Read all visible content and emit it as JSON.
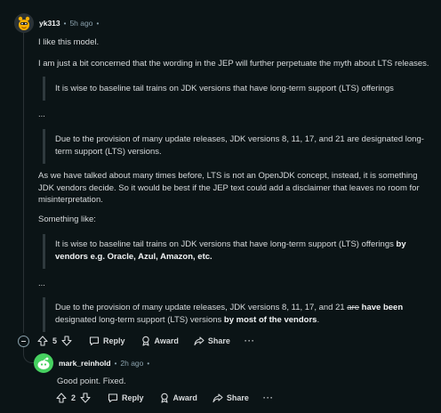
{
  "comment1": {
    "username": "yk313",
    "time": "5h ago",
    "dot": "•",
    "p1": "I like this model.",
    "p2": "I am just a bit concerned that the wording in the JEP will further perpetuate the myth about LTS releases.",
    "q1": "It is wise to baseline tail trains on JDK versions that have long-term support (LTS) offerings",
    "ellipsis1": "...",
    "q2": "Due to the provision of many update releases, JDK versions 8, 11, 17, and 21 are designated long-term support (LTS) versions.",
    "p3": "As we have talked about many times before, LTS is not an OpenJDK concept, instead, it is something JDK vendors decide. So it would be best if the JEP text could add a disclaimer that leaves no room for misinterpretation.",
    "p4": "Something like:",
    "q3_text": "It is wise to baseline tail trains on JDK versions that have long-term support (LTS) offerings ",
    "q3_bold": "by vendors e.g. Oracle, Azul, Amazon, etc.",
    "ellipsis2": "...",
    "q4_text1": "Due to the provision of many update releases, JDK versions 8, 11, 17, and 21 ",
    "q4_strike": "are",
    "q4_bold1": " have been",
    "q4_text2": " designated long-term support (LTS) versions ",
    "q4_bold2": "by most of the vendors",
    "q4_end": ".",
    "score": "5",
    "reply_label": "Reply",
    "award_label": "Award",
    "share_label": "Share",
    "more_label": "···"
  },
  "comment2": {
    "username": "mark_reinhold",
    "time": "2h ago",
    "dot": "•",
    "body": "Good point. Fixed.",
    "score": "2",
    "reply_label": "Reply",
    "award_label": "Award",
    "share_label": "Share",
    "more_label": "···"
  },
  "colors": {
    "background": "#0b1416",
    "text": "#d7dadc",
    "meta": "#8ba2ad",
    "avatar1": "#ffb000",
    "avatar2": "#46d160"
  }
}
